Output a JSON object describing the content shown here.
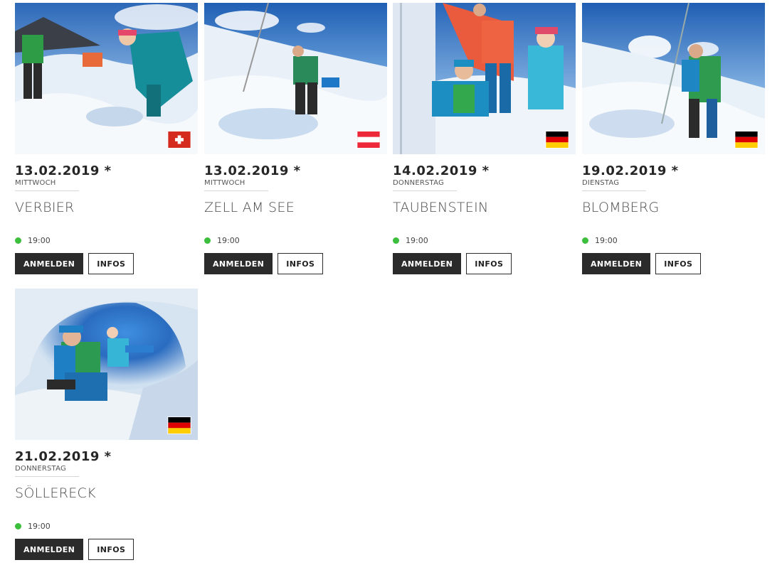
{
  "events": [
    {
      "date": "13.02.2019 *",
      "weekday": "MITTWOCH",
      "location": "VERBIER",
      "time": "19:00",
      "register_label": "ANMELDEN",
      "info_label": "INFOS",
      "flag": "flag-switzerland-icon",
      "photo": "skiers-digging-snow"
    },
    {
      "date": "13.02.2019 *",
      "weekday": "MITTWOCH",
      "location": "ZELL AM SEE",
      "time": "19:00",
      "register_label": "ANMELDEN",
      "info_label": "INFOS",
      "flag": "flag-austria-icon",
      "photo": "skier-shoveling-snow"
    },
    {
      "date": "14.02.2019 *",
      "weekday": "DONNERSTAG",
      "location": "TAUBENSTEIN",
      "time": "19:00",
      "register_label": "ANMELDEN",
      "info_label": "INFOS",
      "flag": "flag-germany-icon",
      "photo": "snow-profile-analysis"
    },
    {
      "date": "19.02.2019 *",
      "weekday": "DIENSTAG",
      "location": "BLOMBERG",
      "time": "19:00",
      "register_label": "ANMELDEN",
      "info_label": "INFOS",
      "flag": "flag-germany-icon",
      "photo": "skier-with-probe"
    },
    {
      "date": "21.02.2019 *",
      "weekday": "DONNERSTAG",
      "location": "SÖLLERECK",
      "time": "19:00",
      "register_label": "ANMELDEN",
      "info_label": "INFOS",
      "flag": "flag-germany-icon",
      "photo": "skiers-in-snow-cave"
    }
  ],
  "colors": {
    "status_dot": "#3cbf3c",
    "button_dark": "#2b2b2b",
    "sky": "#2f6fc0",
    "snow": "#eef3f8"
  }
}
